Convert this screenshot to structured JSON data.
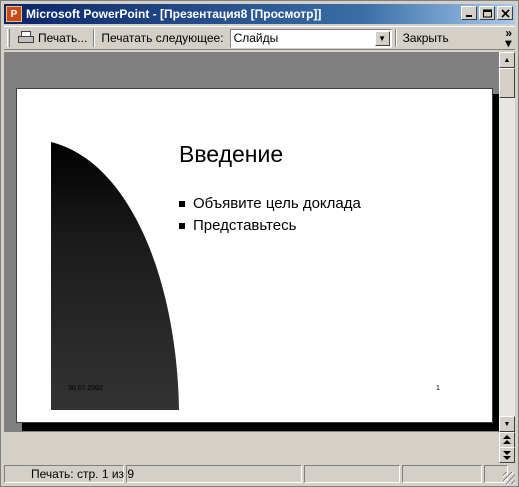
{
  "window": {
    "title": "Microsoft PowerPoint - [Презентация8 [Просмотр]]",
    "icon": "powerpoint-icon",
    "controls": [
      "minimize-icon",
      "restore-icon",
      "close-icon"
    ]
  },
  "toolbar": {
    "print_label": "Печать...",
    "print_what_label": "Печатать следующее:",
    "print_what_value": "Слайды",
    "close_label": "Закрыть",
    "overflow_icon": "chevron-double-right-icon"
  },
  "slide": {
    "title": "Введение",
    "bullets": [
      "Объявите цель доклада",
      "Представьтесь"
    ],
    "date": "30.07.2002",
    "number": "1",
    "accent_colors": [
      "#000000",
      "#333333"
    ]
  },
  "statusbar": {
    "page_text": "Печать: стр. 1 из 9"
  }
}
